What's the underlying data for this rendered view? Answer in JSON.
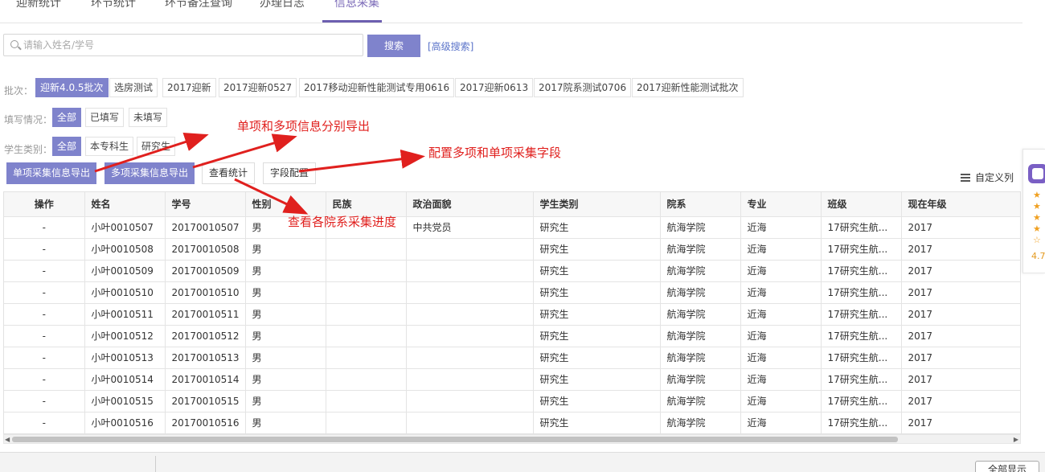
{
  "tabs": {
    "items": [
      {
        "label": "迎新统计"
      },
      {
        "label": "环节统计"
      },
      {
        "label": "环节备注查询"
      },
      {
        "label": "办理日志"
      },
      {
        "label": "信息采集"
      }
    ]
  },
  "search": {
    "placeholder": "请输入姓名/学号",
    "button": "搜索",
    "advanced": "[高级搜索]"
  },
  "filters": {
    "batch_label": "批次：",
    "batches": [
      "迎新4.0.5批次",
      "选房测试",
      "2017迎新",
      "2017迎新0527",
      "2017移动迎新性能测试专用0616",
      "2017迎新0613",
      "2017院系测试0706",
      "2017迎新性能测试批次"
    ],
    "fill_label": "填写情况：",
    "fill_options": [
      "全部",
      "已填写",
      "未填写"
    ],
    "type_label": "学生类别：",
    "type_options": [
      "全部",
      "本专科生",
      "研究生"
    ]
  },
  "actions": {
    "single_export": "单项采集信息导出",
    "multi_export": "多项采集信息导出",
    "view_stats": "查看统计",
    "field_config": "字段配置",
    "custom_columns": "自定义列"
  },
  "table": {
    "columns": [
      "操作",
      "姓名",
      "学号",
      "性别",
      "民族",
      "政治面貌",
      "学生类别",
      "院系",
      "专业",
      "班级",
      "现在年级"
    ],
    "rows": [
      [
        "-",
        "小叶0010507",
        "20170010507",
        "男",
        "",
        "中共党员",
        "研究生",
        "航海学院",
        "近海",
        "17研究生航...",
        "2017"
      ],
      [
        "-",
        "小叶0010508",
        "20170010508",
        "男",
        "",
        "",
        "研究生",
        "航海学院",
        "近海",
        "17研究生航...",
        "2017"
      ],
      [
        "-",
        "小叶0010509",
        "20170010509",
        "男",
        "",
        "",
        "研究生",
        "航海学院",
        "近海",
        "17研究生航...",
        "2017"
      ],
      [
        "-",
        "小叶0010510",
        "20170010510",
        "男",
        "",
        "",
        "研究生",
        "航海学院",
        "近海",
        "17研究生航...",
        "2017"
      ],
      [
        "-",
        "小叶0010511",
        "20170010511",
        "男",
        "",
        "",
        "研究生",
        "航海学院",
        "近海",
        "17研究生航...",
        "2017"
      ],
      [
        "-",
        "小叶0010512",
        "20170010512",
        "男",
        "",
        "",
        "研究生",
        "航海学院",
        "近海",
        "17研究生航...",
        "2017"
      ],
      [
        "-",
        "小叶0010513",
        "20170010513",
        "男",
        "",
        "",
        "研究生",
        "航海学院",
        "近海",
        "17研究生航...",
        "2017"
      ],
      [
        "-",
        "小叶0010514",
        "20170010514",
        "男",
        "",
        "",
        "研究生",
        "航海学院",
        "近海",
        "17研究生航...",
        "2017"
      ],
      [
        "-",
        "小叶0010515",
        "20170010515",
        "男",
        "",
        "",
        "研究生",
        "航海学院",
        "近海",
        "17研究生航...",
        "2017"
      ],
      [
        "-",
        "小叶0010516",
        "20170010516",
        "男",
        "",
        "",
        "研究生",
        "航海学院",
        "近海",
        "17研究生航...",
        "2017"
      ]
    ]
  },
  "bottom": {
    "show_all": "全部显示"
  },
  "widget": {
    "stars": "★★★★☆",
    "rating": "4.7"
  },
  "annotations": {
    "export": "单项和多项信息分别导出",
    "config": "配置多项和单项采集字段",
    "progress": "查看各院系采集进度"
  },
  "colors": {
    "accent": "#7f83cc",
    "annotation": "#e0201e"
  }
}
